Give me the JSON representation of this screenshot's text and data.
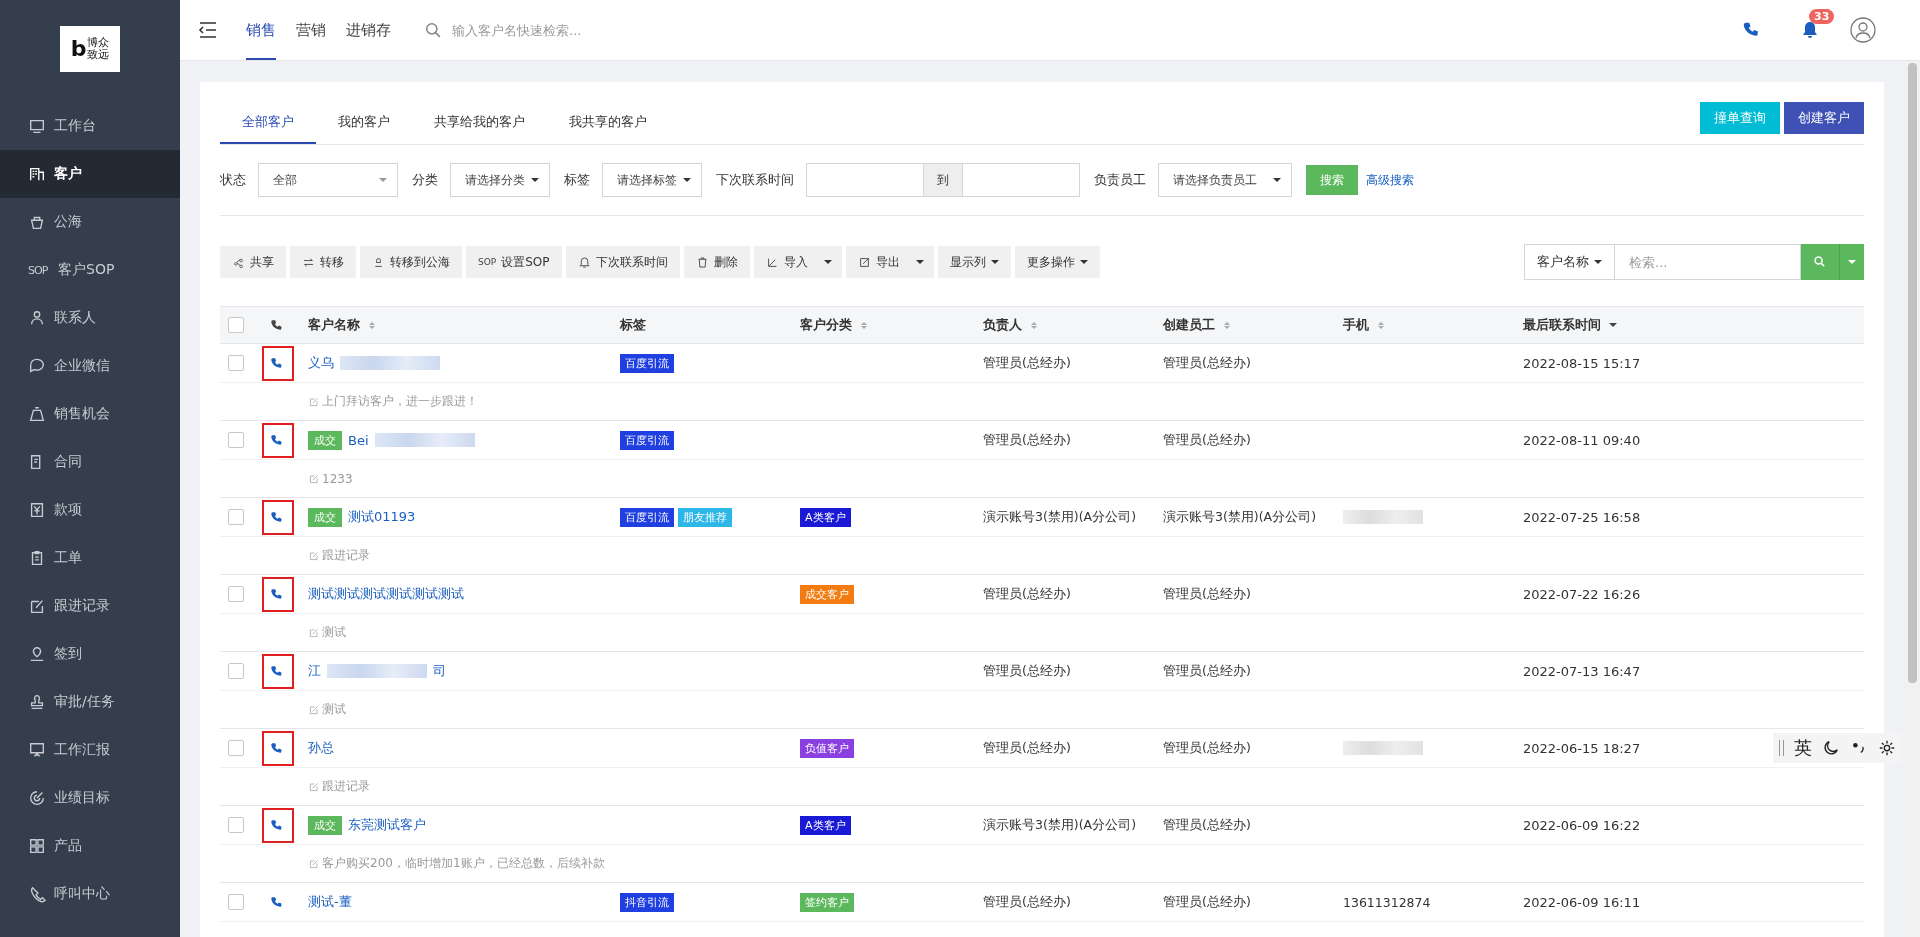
{
  "logo": {
    "mark": "b",
    "line1": "博众",
    "line2": "致远"
  },
  "sidebar": {
    "items": [
      {
        "label": "工作台",
        "selected": false
      },
      {
        "label": "客户",
        "selected": true
      },
      {
        "label": "公海",
        "selected": false
      },
      {
        "label": "客户SOP",
        "selected": false,
        "icon_text": "SOP"
      },
      {
        "label": "联系人",
        "selected": false
      },
      {
        "label": "企业微信",
        "selected": false
      },
      {
        "label": "销售机会",
        "selected": false
      },
      {
        "label": "合同",
        "selected": false
      },
      {
        "label": "款项",
        "selected": false
      },
      {
        "label": "工单",
        "selected": false
      },
      {
        "label": "跟进记录",
        "selected": false
      },
      {
        "label": "签到",
        "selected": false
      },
      {
        "label": "审批/任务",
        "selected": false
      },
      {
        "label": "工作汇报",
        "selected": false
      },
      {
        "label": "业绩目标",
        "selected": false
      },
      {
        "label": "产品",
        "selected": false
      },
      {
        "label": "呼叫中心",
        "selected": false
      }
    ]
  },
  "top_nav": {
    "tabs": [
      {
        "label": "销售",
        "selected": true
      },
      {
        "label": "营销",
        "selected": false
      },
      {
        "label": "进销存",
        "selected": false
      }
    ],
    "search": {
      "placeholder": "输入客户名快速检索..."
    },
    "notifications": "33"
  },
  "tabs": [
    {
      "label": "全部客户",
      "selected": true
    },
    {
      "label": "我的客户",
      "selected": false
    },
    {
      "label": "共享给我的客户",
      "selected": false
    },
    {
      "label": "我共享的客户",
      "selected": false
    }
  ],
  "header_buttons": [
    {
      "label": "撞单查询",
      "color": "#00bcd4"
    },
    {
      "label": "创建客户",
      "color": "#3f51b5"
    }
  ],
  "filters": {
    "status": {
      "label": "状态",
      "value": "全部"
    },
    "category": {
      "label": "分类",
      "value": "请选择分类"
    },
    "tag": {
      "label": "标签",
      "value": "请选择标签"
    },
    "next_contact": {
      "label": "下次联系时间",
      "separator": "到"
    },
    "owner": {
      "label": "负责员工",
      "value": "请选择负责员工"
    },
    "search_button": "搜索",
    "advanced_link": "高级搜索"
  },
  "toolbar": [
    {
      "kind": "button",
      "label": "共享"
    },
    {
      "kind": "button",
      "label": "转移"
    },
    {
      "kind": "button",
      "label": "转移到公海"
    },
    {
      "kind": "button",
      "label": "设置SOP",
      "icon_text": "SOP"
    },
    {
      "kind": "button",
      "label": "下次联系时间"
    },
    {
      "kind": "button",
      "label": "删除"
    },
    {
      "kind": "split",
      "label": "导入"
    },
    {
      "kind": "split",
      "label": "导出"
    },
    {
      "kind": "dropdown",
      "label": "显示列"
    },
    {
      "kind": "dropdown",
      "label": "更多操作"
    }
  ],
  "table_search": {
    "field": "客户名称",
    "placeholder": "检索..."
  },
  "table": {
    "select_all": false,
    "columns": [
      {
        "label": "客户名称",
        "sortable": true,
        "sorted_desc": false
      },
      {
        "label": "标签",
        "sortable": false
      },
      {
        "label": "客户分类",
        "sortable": true,
        "sorted_desc": false
      },
      {
        "label": "负责人",
        "sortable": true,
        "sorted_desc": false
      },
      {
        "label": "创建员工",
        "sortable": true,
        "sorted_desc": false
      },
      {
        "label": "手机",
        "sortable": true,
        "sorted_desc": false
      },
      {
        "label": "最后联系时间",
        "sortable": true,
        "sorted_desc": true
      }
    ],
    "rows": [
      {
        "checked": false,
        "name": "义乌",
        "name_blurred": true,
        "tags": [
          {
            "label": "百度引流",
            "color": "#1f3fe0"
          }
        ],
        "owner": "管理员(总经办)",
        "creator": "管理员(总经办)",
        "time": "2022-08-15 15:17",
        "note": "上门拜访客户，进一步跟进！",
        "framed": true
      },
      {
        "checked": false,
        "badge": "成交",
        "name": "Bei",
        "name_blurred": true,
        "tags": [
          {
            "label": "百度引流",
            "color": "#1f3fe0"
          }
        ],
        "owner": "管理员(总经办)",
        "creator": "管理员(总经办)",
        "time": "2022-08-11 09:40",
        "note": "1233",
        "framed": true
      },
      {
        "checked": false,
        "badge": "成交",
        "name": "测试01193",
        "tags": [
          {
            "label": "百度引流",
            "color": "#1f3fe0"
          },
          {
            "label": "朋友推荐",
            "color": "#2db7e8"
          }
        ],
        "category": {
          "label": "A类客户",
          "color": "#1a1ad6"
        },
        "owner": "演示账号3(禁用)(A分公司)",
        "creator": "演示账号3(禁用)(A分公司)",
        "mobile_blurred": true,
        "time": "2022-07-25 16:58",
        "note": "跟进记录",
        "framed": true
      },
      {
        "checked": false,
        "name": "测试测试测试测试测试测试",
        "tags": [],
        "category": {
          "label": "成交客户",
          "color": "#f47b0f"
        },
        "owner": "管理员(总经办)",
        "creator": "管理员(总经办)",
        "time": "2022-07-22 16:26",
        "note": "测试",
        "framed": true
      },
      {
        "checked": false,
        "name": "江",
        "name_blurred": true,
        "name_tail": "司",
        "tags": [],
        "owner": "管理员(总经办)",
        "creator": "管理员(总经办)",
        "time": "2022-07-13 16:47",
        "note": "测试",
        "framed": true
      },
      {
        "checked": false,
        "name": "孙总",
        "tags": [],
        "category": {
          "label": "负值客户",
          "color": "#8a3fe0"
        },
        "owner": "管理员(总经办)",
        "creator": "管理员(总经办)",
        "mobile_blurred": true,
        "time": "2022-06-15 18:27",
        "note": "跟进记录",
        "framed": true
      },
      {
        "checked": false,
        "badge": "成交",
        "name": "东莞测试客户",
        "tags": [],
        "category": {
          "label": "A类客户",
          "color": "#1a1ad6"
        },
        "owner": "演示账号3(禁用)(A分公司)",
        "creator": "管理员(总经办)",
        "time": "2022-06-09 16:22",
        "note": "客户购买200，临时增加1账户，已经总数，后续补款",
        "framed": true
      },
      {
        "checked": false,
        "name": "测试-董",
        "tags": [
          {
            "label": "抖音引流",
            "color": "#1f3fe0"
          }
        ],
        "category": {
          "label": "签约客户",
          "color": "#5cb85c"
        },
        "owner": "管理员(总经办)",
        "creator": "管理员(总经办)",
        "mobile": "13611312874",
        "time": "2022-06-09 16:11",
        "framed": false
      }
    ]
  },
  "ime_bar": {
    "mode": "英"
  }
}
